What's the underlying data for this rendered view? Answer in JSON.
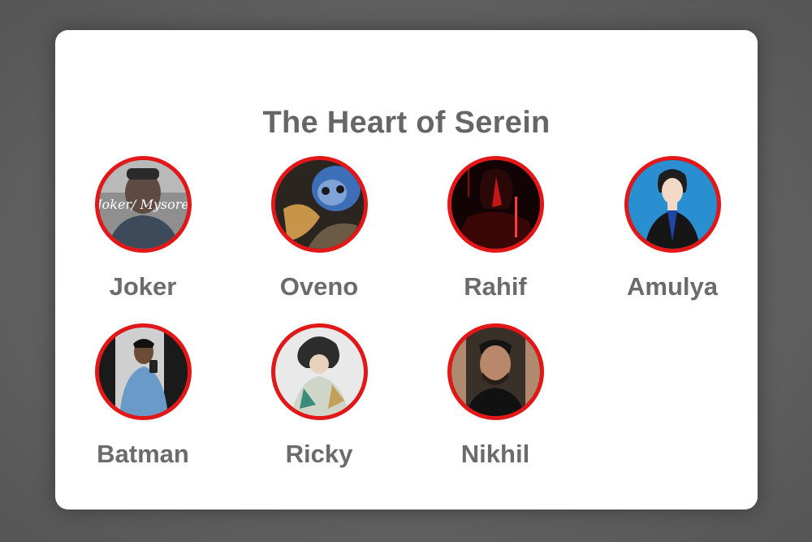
{
  "dialog": {
    "title": "The Heart of Serein"
  },
  "members": [
    {
      "name": "Joker",
      "avatar_text": "Joker/ Mysore"
    },
    {
      "name": "Oveno"
    },
    {
      "name": "Rahif"
    },
    {
      "name": "Amulya"
    },
    {
      "name": "Batman"
    },
    {
      "name": "Ricky"
    },
    {
      "name": "Nikhil"
    }
  ],
  "colors": {
    "ring": "#e31717",
    "name_text": "#6b6b6b",
    "title_text": "#666666",
    "backdrop": "#636363",
    "card": "#ffffff"
  }
}
